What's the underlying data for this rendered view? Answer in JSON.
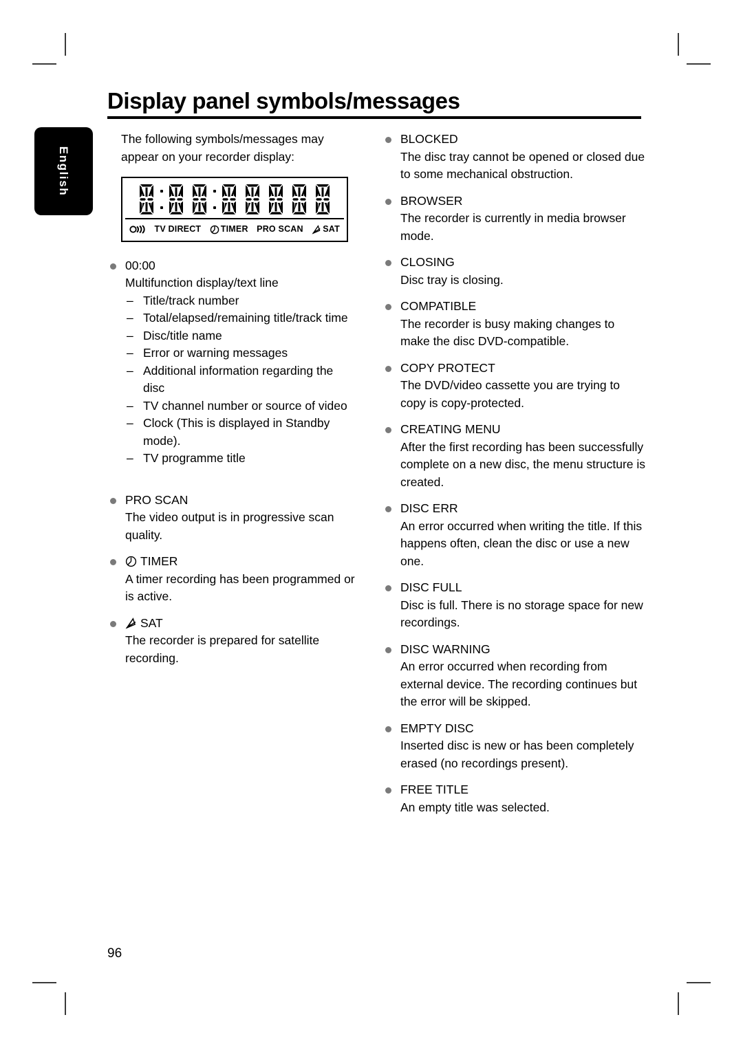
{
  "language_tab": {
    "label": "English"
  },
  "heading": {
    "title": "Display panel symbols/messages"
  },
  "page_number": "96",
  "intro": {
    "line1": "The following symbols/messages may",
    "line2": "appear on your recorder display:"
  },
  "display_panel": {
    "digit_count": 8,
    "separator_glyph": "dot-separator",
    "labels": [
      {
        "icon": "power-standby-icon",
        "text": ""
      },
      {
        "icon": "",
        "text": "TV DIRECT"
      },
      {
        "icon": "clock-icon",
        "text": "TIMER"
      },
      {
        "icon": "",
        "text": "PRO SCAN"
      },
      {
        "icon": "satellite-dish-icon",
        "text": "SAT"
      }
    ]
  },
  "left_column": {
    "entries": [
      {
        "term": "00:00",
        "icon": "",
        "desc": "Multifunction display/text line",
        "sublist": [
          "Title/track number",
          "Total/elapsed/remaining title/track time",
          "Disc/title name",
          "Error or warning messages",
          "Additional information regarding the disc",
          "TV channel number or source of video",
          "Clock (This is displayed in Standby mode).",
          "TV programme title"
        ]
      },
      {
        "term": "PRO SCAN",
        "icon": "",
        "desc": "The video output is in progressive scan quality."
      },
      {
        "term": "TIMER",
        "icon": "clock-icon",
        "desc": "A timer recording has been programmed or is active."
      },
      {
        "term": "SAT",
        "icon": "satellite-dish-icon",
        "desc": "The recorder is prepared for satellite recording."
      }
    ]
  },
  "right_column": {
    "entries": [
      {
        "term": "BLOCKED",
        "desc": "The disc tray cannot be opened or closed due to some mechanical obstruction."
      },
      {
        "term": "BROWSER",
        "desc": "The recorder is currently in media browser mode."
      },
      {
        "term": "CLOSING",
        "desc": "Disc tray is closing."
      },
      {
        "term": "COMPATIBLE",
        "desc": "The recorder is busy making changes to make the disc DVD-compatible."
      },
      {
        "term": "COPY PROTECT",
        "desc": "The DVD/video cassette you are trying to copy is copy-protected."
      },
      {
        "term": "CREATING MENU",
        "desc": "After the first recording has been successfully complete on a new disc, the menu structure is created."
      },
      {
        "term": "DISC ERR",
        "desc": "An error occurred when writing the title. If this happens often, clean the disc or use a new one."
      },
      {
        "term": "DISC FULL",
        "desc": "Disc is full. There is no storage space for new recordings."
      },
      {
        "term": "DISC WARNING",
        "desc": "An error occurred when recording from external device. The recording continues but the error will be skipped."
      },
      {
        "term": "EMPTY DISC",
        "desc": "Inserted disc is new or has been completely erased (no recordings present)."
      },
      {
        "term": "FREE TITLE",
        "desc": "An empty title was selected."
      }
    ]
  },
  "colors": {
    "bullet": "#7a7a7a",
    "text": "#000000",
    "tab_background": "#000000",
    "tab_text": "#ffffff",
    "crop_mark": "#3a3a3a"
  }
}
